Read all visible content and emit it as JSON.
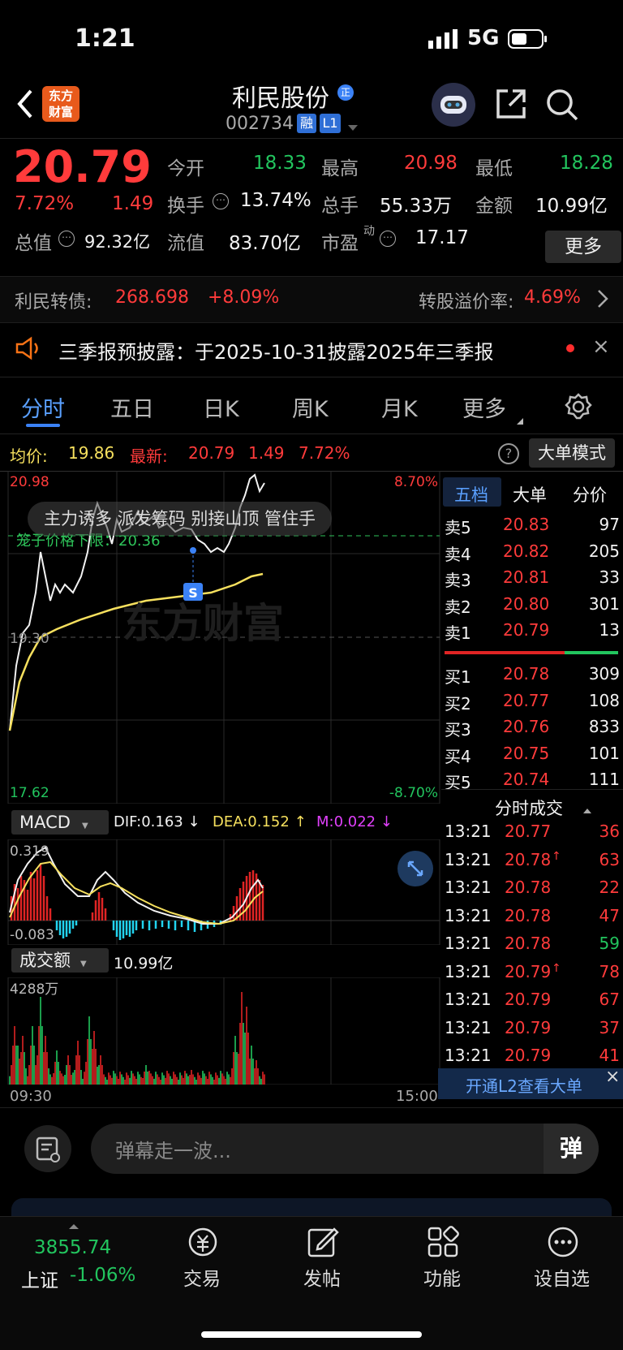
{
  "status_bar": {
    "time": "1:21",
    "network": "5G"
  },
  "header": {
    "logo_line1": "东方",
    "logo_line2": "财富",
    "stock_name": "利民股份",
    "badge_zheng": "正",
    "stock_code": "002734",
    "tag_rong": "融",
    "tag_l1": "L1"
  },
  "quote": {
    "price": "20.79",
    "change_pct": "7.72%",
    "change_amt": "1.49",
    "open_label": "今开",
    "open": "18.33",
    "high_label": "最高",
    "high": "20.98",
    "low_label": "最低",
    "low": "18.28",
    "turnover_label": "换手",
    "turnover": "13.74%",
    "volume_label": "总手",
    "volume": "55.33万",
    "amount_label": "金额",
    "amount": "10.99亿",
    "mcap_label": "总值",
    "mcap": "92.32亿",
    "float_label": "流值",
    "float": "83.70亿",
    "pe_label": "市盈",
    "pe_sup": "动",
    "pe": "17.17",
    "more_button": "更多"
  },
  "bond": {
    "label": "利民转债:",
    "price": "268.698",
    "change": "+8.09%",
    "premium_label": "转股溢价率:",
    "premium": "4.69%"
  },
  "notice": {
    "text": "三季报预披露：于2025-10-31披露2025年三季报"
  },
  "tabs": [
    "分时",
    "五日",
    "日K",
    "周K",
    "月K",
    "更多"
  ],
  "chart_header": {
    "avg_label": "均价:",
    "avg": "19.86",
    "latest_label": "最新:",
    "latest": "20.79",
    "latest_chg": "1.49",
    "latest_pct": "7.72%",
    "big_order_button": "大单模式"
  },
  "chart_labels": {
    "y_top": "20.98",
    "y_mid": "19.30",
    "y_bottom": "17.62",
    "pct_top": "8.70%",
    "pct_bottom": "-8.70%",
    "danmaku": "主力诱多 派发筹码 别接山顶 管住手",
    "cage_price": "笼子价格下限：20.36",
    "marker_s": "S",
    "watermark": "东方财富",
    "time_start": "09:30",
    "time_end": "15:00"
  },
  "macd": {
    "selector": "MACD",
    "dif_label": "DIF:0.163",
    "dif_arrow": "↓",
    "dea_label": "DEA:0.152",
    "dea_arrow": "↑",
    "m_label": "M:0.022",
    "m_arrow": "↓",
    "y_top": "0.319",
    "y_bottom": "-0.083"
  },
  "volume_panel": {
    "selector": "成交额",
    "value": "10.99亿",
    "y_top": "4288万"
  },
  "order_book": {
    "tabs": [
      "五档",
      "大单",
      "分价"
    ],
    "asks": [
      {
        "label": "卖5",
        "price": "20.83",
        "qty": "97"
      },
      {
        "label": "卖4",
        "price": "20.82",
        "qty": "205"
      },
      {
        "label": "卖3",
        "price": "20.81",
        "qty": "33"
      },
      {
        "label": "卖2",
        "price": "20.80",
        "qty": "301"
      },
      {
        "label": "卖1",
        "price": "20.79",
        "qty": "13"
      }
    ],
    "bids": [
      {
        "label": "买1",
        "price": "20.78",
        "qty": "309"
      },
      {
        "label": "买2",
        "price": "20.77",
        "qty": "108"
      },
      {
        "label": "买3",
        "price": "20.76",
        "qty": "833"
      },
      {
        "label": "买4",
        "price": "20.75",
        "qty": "101"
      },
      {
        "label": "买5",
        "price": "20.74",
        "qty": "111"
      }
    ]
  },
  "trades": {
    "title": "分时成交",
    "rows": [
      {
        "time": "13:21",
        "price": "20.77",
        "arrow": "",
        "qty": "36",
        "qty_color": "red"
      },
      {
        "time": "13:21",
        "price": "20.78",
        "arrow": "↑",
        "qty": "63",
        "qty_color": "red"
      },
      {
        "time": "13:21",
        "price": "20.78",
        "arrow": "",
        "qty": "22",
        "qty_color": "red"
      },
      {
        "time": "13:21",
        "price": "20.78",
        "arrow": "",
        "qty": "47",
        "qty_color": "red"
      },
      {
        "time": "13:21",
        "price": "20.78",
        "arrow": "",
        "qty": "59",
        "qty_color": "green"
      },
      {
        "time": "13:21",
        "price": "20.79",
        "arrow": "↑",
        "qty": "78",
        "qty_color": "red"
      },
      {
        "time": "13:21",
        "price": "20.79",
        "arrow": "",
        "qty": "67",
        "qty_color": "red"
      },
      {
        "time": "13:21",
        "price": "20.79",
        "arrow": "",
        "qty": "37",
        "qty_color": "red"
      },
      {
        "time": "13:21",
        "price": "20.79",
        "arrow": "",
        "qty": "41",
        "qty_color": "red"
      }
    ],
    "l2_banner": "开通L2查看大单"
  },
  "comment": {
    "placeholder": "弹幕走一波...",
    "danmu_btn": "弹"
  },
  "bottom_nav": {
    "index_value": "3855.74",
    "index_name": "上证",
    "index_change": "-1.06%",
    "trade": "交易",
    "post": "发帖",
    "functions": "功能",
    "watchlist": "设自选"
  }
}
